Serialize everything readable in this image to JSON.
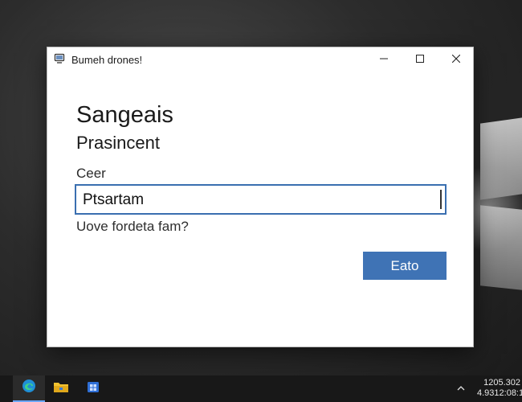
{
  "window": {
    "title": "Bumeh drones!",
    "icon": "app-window-icon",
    "controls": {
      "minimize_icon": "minimize-icon",
      "maximize_icon": "maximize-icon",
      "close_icon": "close-icon"
    }
  },
  "dialog": {
    "heading": "Sangeais",
    "subheading": "Prasincent",
    "field_label": "Ceer",
    "field_value": "Ptsartam",
    "forgot_link": "Uove fordeta fam?",
    "primary_button": "Eato"
  },
  "taskbar": {
    "apps": [
      {
        "name": "edge-icon",
        "active": true
      },
      {
        "name": "file-explorer-icon",
        "active": false
      },
      {
        "name": "store-icon",
        "active": false
      }
    ],
    "tray_icon": "chevron-up-icon",
    "clock": {
      "time": "1205.302",
      "date": "4.9312:08:1"
    }
  },
  "colors": {
    "accent": "#3f73b5",
    "field_border": "#3a6fb0",
    "taskbar": "#181818"
  }
}
